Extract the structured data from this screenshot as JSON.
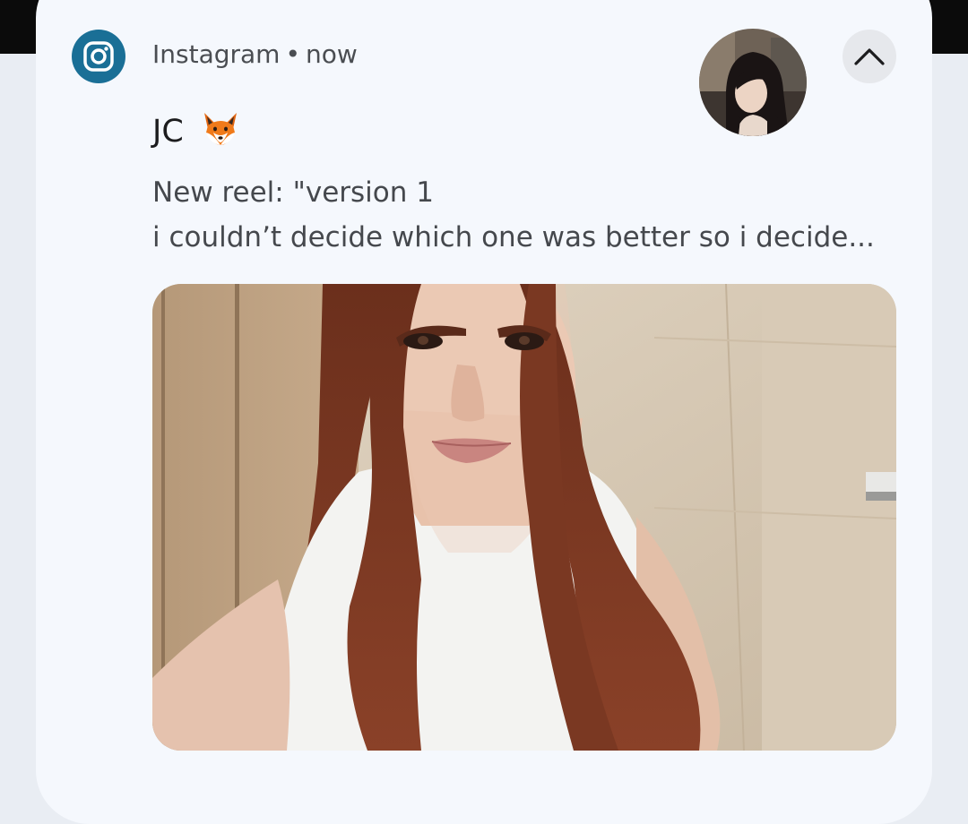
{
  "notification": {
    "app_name": "Instagram",
    "separator": "•",
    "time": "now",
    "app_icon": "instagram-icon",
    "sender_name": "JC",
    "sender_emoji": "fox-emoji",
    "message_line1": "New reel: \"version 1",
    "message_line2": "i couldn’t decide which one was better so i decide...",
    "collapse_icon": "chevron-up-icon",
    "avatar": "profile-photo",
    "media": "reel-preview-photo"
  },
  "colors": {
    "app_icon_bg": "#1a6f96",
    "card_bg": "#f5f8fd",
    "screen_bg": "#e9edf3",
    "button_bg": "#e6e8ec",
    "text_primary": "#1c1c1e",
    "text_secondary": "#45484d"
  }
}
